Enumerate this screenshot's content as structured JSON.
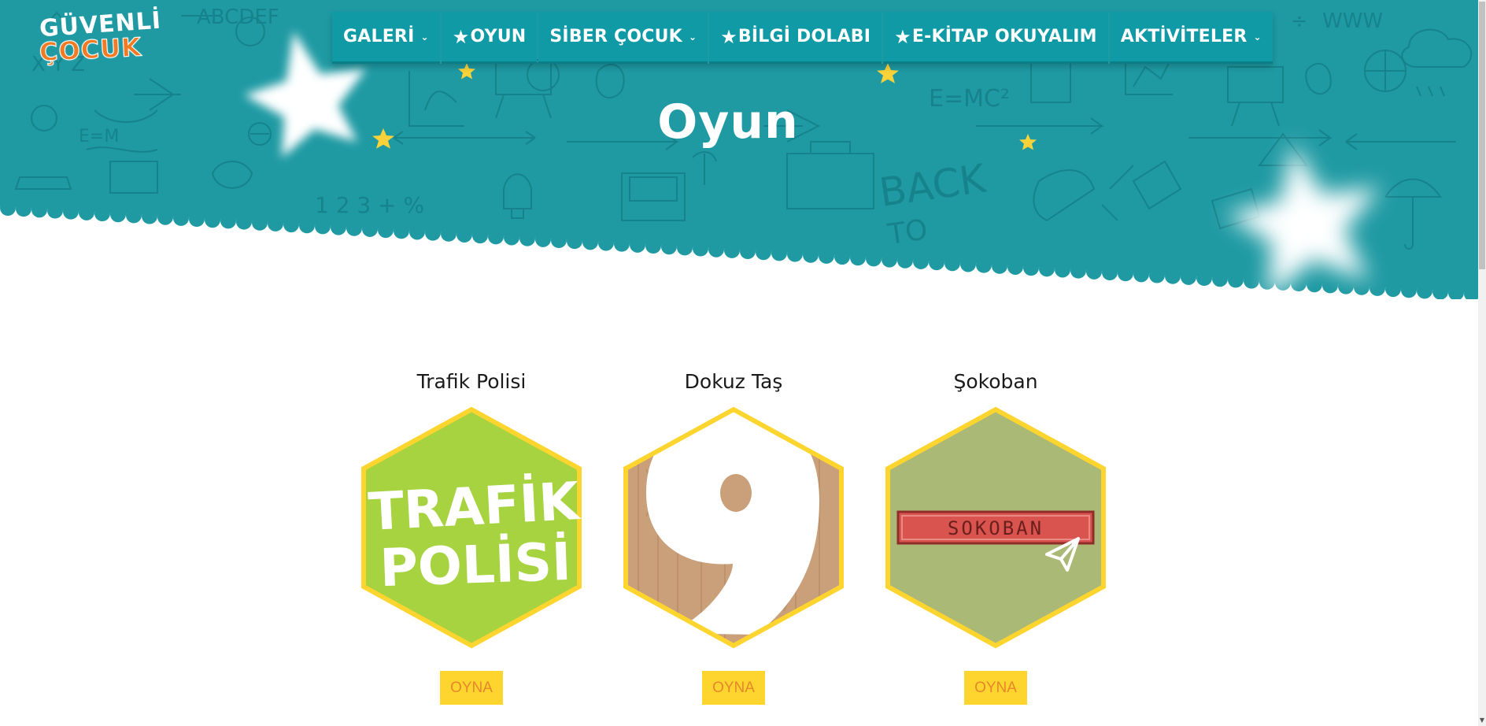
{
  "site": {
    "logo_line1": "GÜVENLİ",
    "logo_line2": "ÇOCUK"
  },
  "nav": {
    "items": [
      {
        "label": "GALERİ",
        "star": false,
        "dropdown": true
      },
      {
        "label": "OYUN",
        "star": true,
        "dropdown": false
      },
      {
        "label": "SİBER ÇOCUK",
        "star": false,
        "dropdown": true
      },
      {
        "label": "BİLGİ DOLABI",
        "star": true,
        "dropdown": false
      },
      {
        "label": "E-KİTAP OKUYALIM",
        "star": true,
        "dropdown": false
      },
      {
        "label": "AKTİVİTELER",
        "star": false,
        "dropdown": true
      }
    ],
    "star_glyph": "★",
    "caret_glyph": "⌄"
  },
  "page": {
    "title": "Oyun"
  },
  "games": [
    {
      "title": "Trafik Polisi",
      "image_text_1": "TRAFİK",
      "image_text_2": "POLİSİ",
      "button": "OYNA"
    },
    {
      "title": "Dokuz Taş",
      "image_text_1": "9",
      "button": "OYNA"
    },
    {
      "title": "Şokoban",
      "image_text_1": "SOKOBAN",
      "button": "OYNA"
    }
  ],
  "colors": {
    "header_teal": "#1f9aa3",
    "nav_teal": "#0f9aa6",
    "hex_border": "#fdd52e",
    "button_bg": "#fdd52e",
    "button_text": "#e8872a",
    "trafik_green": "#a6d33f",
    "sokoban_olive": "#abb976",
    "wood": "#c9a07a"
  },
  "icons": [
    "star-icon",
    "chevron-down-icon",
    "paper-plane-icon"
  ]
}
